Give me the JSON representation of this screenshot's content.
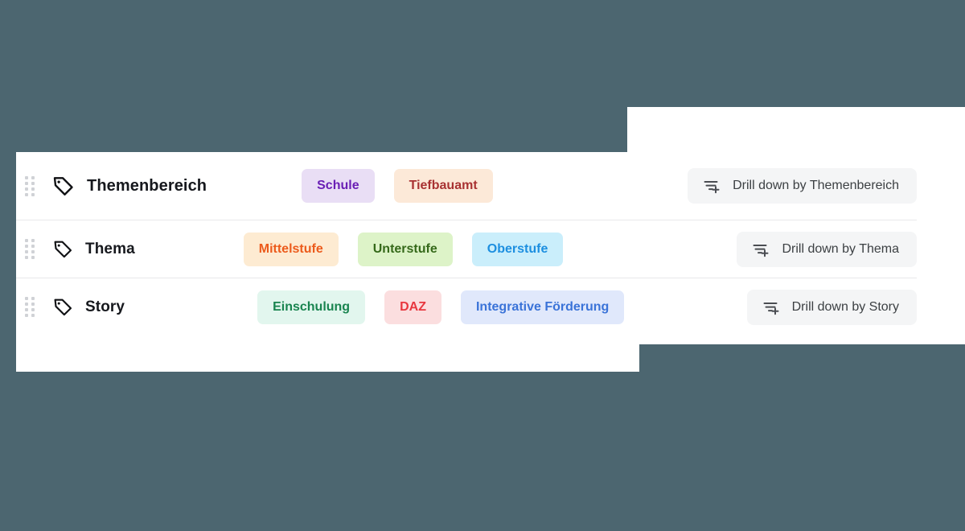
{
  "theme": {
    "page_background": "#4c6670",
    "panel_background": "#ffffff",
    "divider": "#e8e8ea",
    "button_background": "#f4f5f6",
    "button_text": "#3c4043",
    "label_text": "#16181d",
    "drag_handle_dot": "#d0d2d6"
  },
  "rows": [
    {
      "drag_handle_icon": "drag-handle-icon",
      "tag_icon": "tag-icon",
      "label": "Themenbereich",
      "chips": [
        {
          "label": "Schule",
          "bg": "#e9def5",
          "fg": "#6a1fb5"
        },
        {
          "label": "Tiefbauamt",
          "bg": "#fce9d8",
          "fg": "#a83232"
        }
      ],
      "drill_button": {
        "label": "Drill down by Themenbereich",
        "icon": "filter-plus-icon"
      }
    },
    {
      "drag_handle_icon": "drag-handle-icon",
      "tag_icon": "tag-icon",
      "label": "Thema",
      "chips": [
        {
          "label": "Mittelstufe",
          "bg": "#fdebd2",
          "fg": "#ec5b1c"
        },
        {
          "label": "Unterstufe",
          "bg": "#ddf3c8",
          "fg": "#35691a"
        },
        {
          "label": "Oberstufe",
          "bg": "#caeefb",
          "fg": "#1d8fe0"
        }
      ],
      "drill_button": {
        "label": "Drill down by Thema",
        "icon": "filter-plus-icon"
      }
    },
    {
      "drag_handle_icon": "drag-handle-icon",
      "tag_icon": "tag-icon",
      "label": "Story",
      "chips": [
        {
          "label": "Einschulung",
          "bg": "#e2f6ee",
          "fg": "#19844f"
        },
        {
          "label": "DAZ",
          "bg": "#fbdedf",
          "fg": "#e8373f"
        },
        {
          "label": "Integrative Förderung",
          "bg": "#e0e8fb",
          "fg": "#3a73d8"
        }
      ],
      "drill_button": {
        "label": "Drill down by Story",
        "icon": "filter-plus-icon"
      }
    }
  ]
}
